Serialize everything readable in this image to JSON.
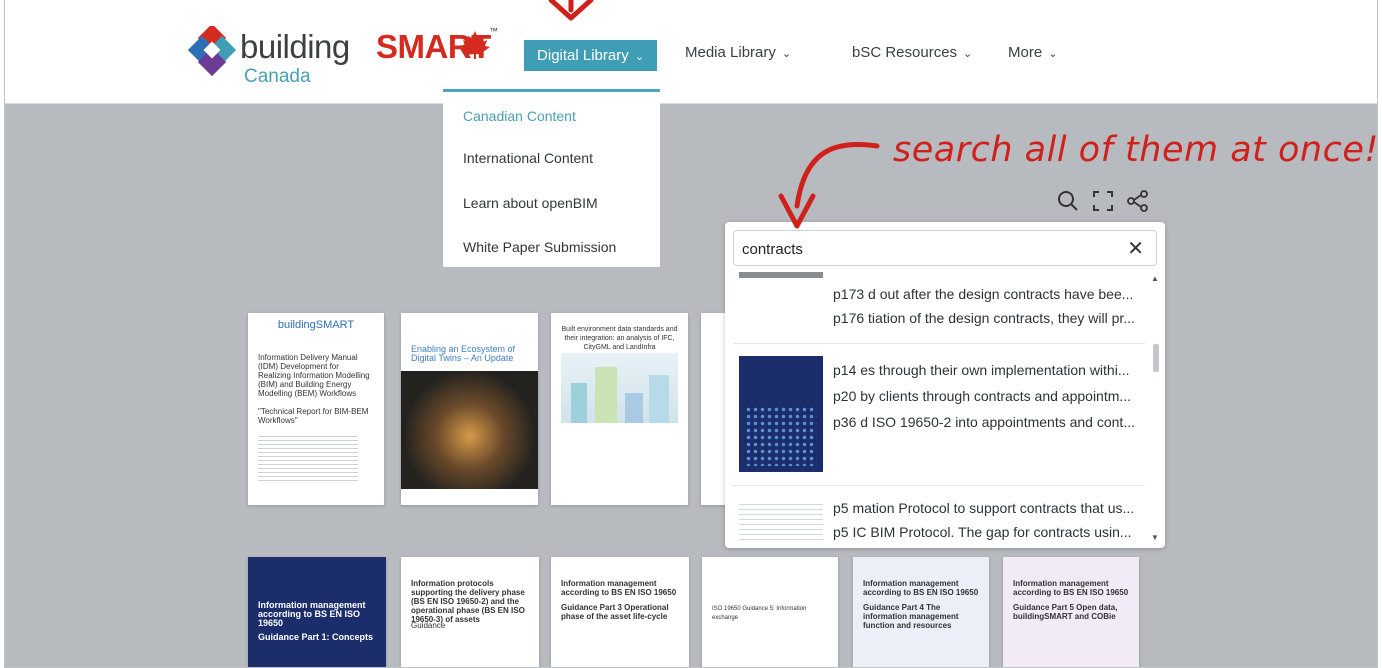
{
  "brand": {
    "name_part1": "building",
    "name_part2": "SMART",
    "trademark": "™",
    "subtitle": "Canada",
    "colors": {
      "red": "#d42a1f",
      "teal": "#3f9db6",
      "purple": "#6b3c94",
      "blue": "#2d6fb7"
    }
  },
  "nav": {
    "items": [
      {
        "label": "Digital Library",
        "active": true
      },
      {
        "label": "Media Library",
        "active": false
      },
      {
        "label": "bSC Resources",
        "active": false
      },
      {
        "label": "More",
        "active": false
      }
    ],
    "chevron": "⌄"
  },
  "dropdown": {
    "items": [
      "Canadian Content",
      "International Content",
      "Learn about openBIM",
      "White Paper Submission"
    ]
  },
  "annotation": {
    "text": "search all of them at once!",
    "color": "#d0201b"
  },
  "toolbar": {
    "icons": [
      "search-icon",
      "fullscreen-icon",
      "share-icon"
    ]
  },
  "search": {
    "value": "contracts",
    "clear_glyph": "✕",
    "results": [
      {
        "lines": [
          "p173 d out after the design contracts have bee...",
          "p176 tiation of the design contracts, they will pr..."
        ]
      },
      {
        "lines": [
          "p14 es through their own implementation withi...",
          "p20 by clients through contracts and appointm...",
          "p36 d ISO 19650-2 into appointments and cont..."
        ]
      },
      {
        "lines": [
          "p5 mation Protocol to support contracts that us...",
          "p5 IC BIM Protocol. The gap for contracts usin..."
        ]
      }
    ]
  },
  "documents": {
    "row1": [
      {
        "brand": "buildingSMART",
        "title": "Information Delivery Manual (IDM) Development for Realizing Information Modelling (BIM) and Building Energy Modelling (BEM) Workflows",
        "subtitle": "\"Technical Report for BIM-BEM Workflows\""
      },
      {
        "title": "Enabling an Ecosystem of Digital Twins – An Update"
      },
      {
        "title": "Built environment data standards and their integration: an analysis of IFC, CityGML and LandInfra"
      },
      {
        "title": ""
      }
    ],
    "row2": [
      {
        "title": "Information management according to BS EN ISO 19650",
        "subtitle": "Guidance Part 1: Concepts"
      },
      {
        "title": "Information protocols supporting the delivery phase (BS EN ISO 19650-2) and the operational phase (BS EN ISO 19650-3) of assets",
        "subtitle": "Guidance"
      },
      {
        "title": "Information management according to BS EN ISO 19650",
        "subtitle": "Guidance Part 3 Operational phase of the asset life-cycle"
      },
      {
        "title": "ISO 19650 Guidance 5: Information exchange"
      },
      {
        "title": "Information management according to BS EN ISO 19650",
        "subtitle": "Guidance Part 4 The information management function and resources"
      },
      {
        "title": "Information management according to BS EN ISO 19650",
        "subtitle": "Guidance Part 5 Open data, buildingSMART and COBie"
      }
    ]
  }
}
